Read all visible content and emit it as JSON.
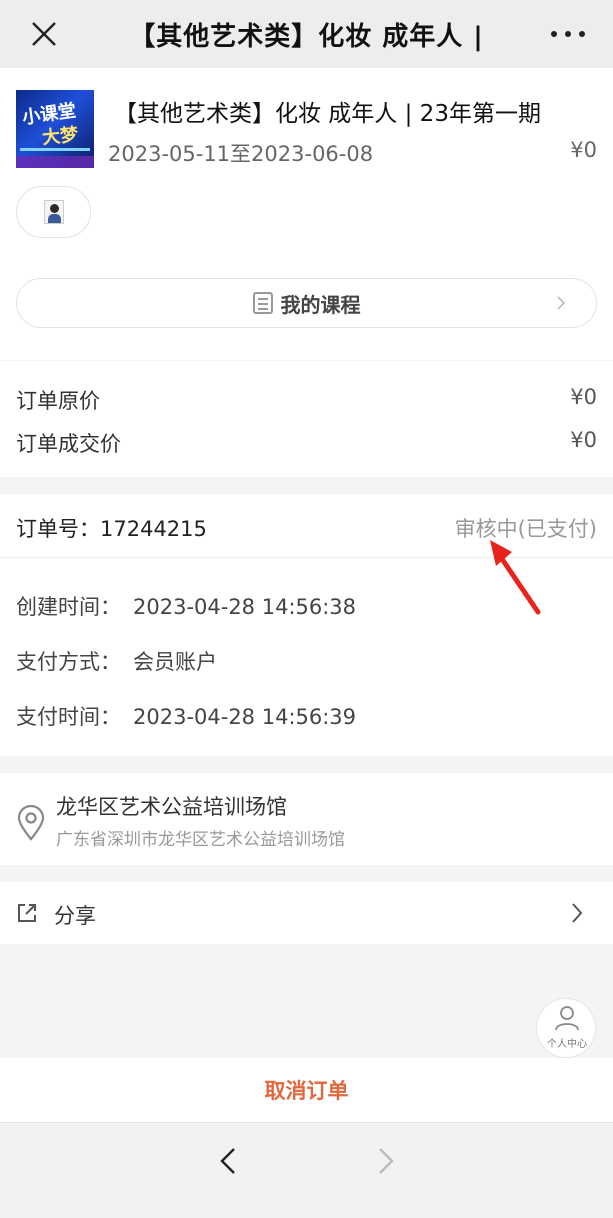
{
  "header": {
    "title": "【其他艺术类】化妆 成年人 |",
    "close_icon": "close-icon",
    "more_icon": "more-dots-icon"
  },
  "course": {
    "thumb_text_1": "小课堂",
    "thumb_text_2": "大梦",
    "title": "【其他艺术类】化妆 成年人 | 23年第一期",
    "dates": "2023-05-11至2023-06-08",
    "price": "¥0",
    "my_course_label": "我的课程"
  },
  "pricing": {
    "original_label": "订单原价",
    "original_value": "¥0",
    "deal_label": "订单成交价",
    "deal_value": "¥0"
  },
  "order": {
    "number_label": "订单号：",
    "number": "17244215",
    "status": "审核中(已支付)",
    "created_label": "创建时间：",
    "created_value": "2023-04-28 14:56:38",
    "pay_method_label": "支付方式：",
    "pay_method_value": "会员账户",
    "pay_time_label": "支付时间：",
    "pay_time_value": "2023-04-28 14:56:39"
  },
  "location": {
    "name": "龙华区艺术公益培训场馆",
    "address": "广东省深圳市龙华区艺术公益培训场馆"
  },
  "share": {
    "label": "分享"
  },
  "profile": {
    "caption": "个人中心"
  },
  "actions": {
    "cancel_label": "取消订单"
  },
  "colors": {
    "accent": "#e1673f",
    "annotation_arrow": "#e8231c"
  }
}
